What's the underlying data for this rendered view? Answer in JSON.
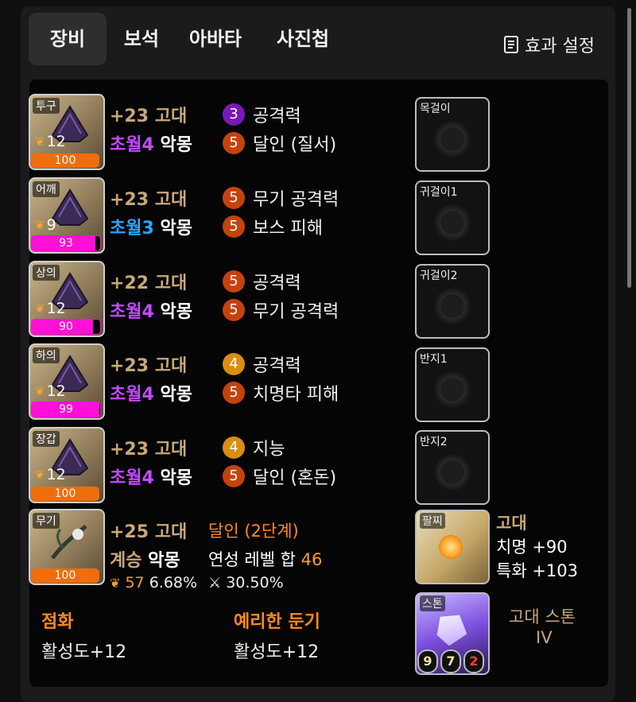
{
  "tabs": [
    "장비",
    "보석",
    "아바타",
    "사진첩"
  ],
  "effect_label": "효과 설정",
  "equipment": [
    {
      "slot": "투구",
      "level": "12",
      "quality": "100",
      "quality_pct": 100,
      "quality_color": "orange",
      "upgrade": "+23",
      "grade": "고대",
      "tier_label": "초월4",
      "tier_color": "purple",
      "set": "악몽",
      "stats": [
        {
          "num": "3",
          "color": "purple",
          "text": "공격력"
        },
        {
          "num": "5",
          "color": "orange",
          "text": "달인 (질서)"
        }
      ]
    },
    {
      "slot": "어깨",
      "level": "9",
      "quality": "93",
      "quality_pct": 93,
      "quality_color": "pink",
      "upgrade": "+23",
      "grade": "고대",
      "tier_label": "초월3",
      "tier_color": "blue",
      "set": "악몽",
      "stats": [
        {
          "num": "5",
          "color": "orange",
          "text": "무기 공격력"
        },
        {
          "num": "5",
          "color": "orange",
          "text": "보스 피해"
        }
      ]
    },
    {
      "slot": "상의",
      "level": "12",
      "quality": "90",
      "quality_pct": 90,
      "quality_color": "pink",
      "upgrade": "+22",
      "grade": "고대",
      "tier_label": "초월4",
      "tier_color": "purple",
      "set": "악몽",
      "stats": [
        {
          "num": "5",
          "color": "orange",
          "text": "공격력"
        },
        {
          "num": "5",
          "color": "orange",
          "text": "무기 공격력"
        }
      ]
    },
    {
      "slot": "하의",
      "level": "12",
      "quality": "99",
      "quality_pct": 99,
      "quality_color": "pink",
      "upgrade": "+23",
      "grade": "고대",
      "tier_label": "초월4",
      "tier_color": "purple",
      "set": "악몽",
      "stats": [
        {
          "num": "4",
          "color": "yellow",
          "text": "공격력"
        },
        {
          "num": "5",
          "color": "orange",
          "text": "치명타 피해"
        }
      ]
    },
    {
      "slot": "장갑",
      "level": "12",
      "quality": "100",
      "quality_pct": 100,
      "quality_color": "orange",
      "upgrade": "+23",
      "grade": "고대",
      "tier_label": "초월4",
      "tier_color": "purple",
      "set": "악몽",
      "stats": [
        {
          "num": "4",
          "color": "yellow",
          "text": "지능"
        },
        {
          "num": "5",
          "color": "orange",
          "text": "달인 (혼돈)"
        }
      ]
    }
  ],
  "weapon": {
    "slot": "무기",
    "quality": "100",
    "upgrade": "+25",
    "grade": "고대",
    "mastery": "달인 (2단계)",
    "inherit": "계승",
    "set": "악몽",
    "setlevel_label": "연성 레벨 합",
    "setlevel": "46",
    "elixir_val": "57",
    "elixir_pct": "6.68%",
    "sword_pct": "30.50%"
  },
  "accessories": [
    "목걸이",
    "귀걸이1",
    "귀걸이2",
    "반지1",
    "반지2"
  ],
  "bracelet": {
    "slot": "팔찌",
    "grade": "고대",
    "stats": [
      "치명 +90",
      "특화 +103"
    ]
  },
  "stone": {
    "slot": "스톤",
    "name": "고대 스톤",
    "tier": "IV",
    "nums": [
      "9",
      "7",
      "2"
    ]
  },
  "engravings": [
    {
      "name": "점화",
      "value": "활성도+12"
    },
    {
      "name": "예리한 둔기",
      "value": "활성도+12"
    }
  ]
}
